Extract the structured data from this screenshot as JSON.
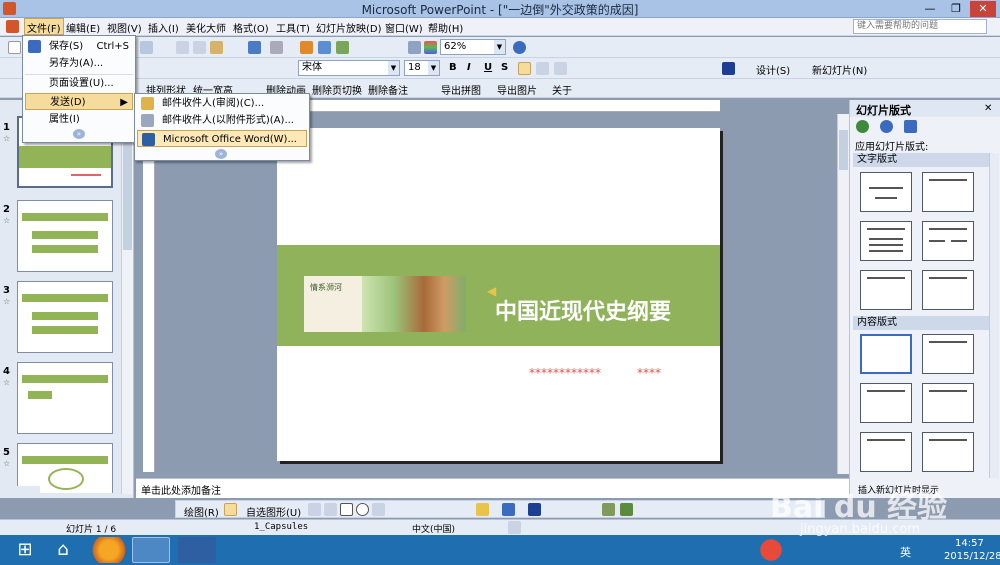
{
  "window": {
    "title": "Microsoft PowerPoint - [\"一边倒\"外交政策的成因]",
    "help_placeholder": "键入需要帮助的问题"
  },
  "menu": [
    "文件(F)",
    "编辑(E)",
    "视图(V)",
    "插入(I)",
    "美化大师",
    "格式(O)",
    "工具(T)",
    "幻灯片放映(D)",
    "窗口(W)",
    "帮助(H)"
  ],
  "toolbar": {
    "zoom": "62%",
    "font": "宋体",
    "size": "18",
    "bold": "B",
    "italic": "I",
    "underline": "U",
    "shadow": "S",
    "design": "设计(S)",
    "new_slide": "新幻灯片(N)"
  },
  "toolbar3": {
    "arrange": "排列形状",
    "uniform": "统一宽高",
    "delete_anim": "删除动画",
    "delete_transition": "删除页切换",
    "delete_notes": "删除备注",
    "export_puzzle": "导出拼图",
    "export_pic": "导出图片",
    "about": "关于"
  },
  "file_menu": {
    "save": "保存(S)",
    "save_shortcut": "Ctrl+S",
    "save_as": "另存为(A)...",
    "page_setup": "页面设置(U)...",
    "send": "发送(D)",
    "properties": "属性(I)"
  },
  "send_menu": {
    "mail_review": "邮件收件人(审阅)(C)...",
    "mail_attach": "邮件收件人(以附件形式)(A)...",
    "word": "Microsoft Office Word(W)..."
  },
  "slides": [
    {
      "num": "1"
    },
    {
      "num": "2"
    },
    {
      "num": "3"
    },
    {
      "num": "4"
    },
    {
      "num": "5"
    }
  ],
  "slide": {
    "title": "中国近现代史纲要",
    "stars_a": "************",
    "stars_b": "****",
    "photo_text": "情系浉河"
  },
  "notes_placeholder": "单击此处添加备注",
  "taskpane": {
    "title": "幻灯片版式",
    "apply": "应用幻灯片版式:",
    "text_layouts": "文字版式",
    "content_layouts": "内容版式",
    "footer_hint": "插入新幻灯片时显示"
  },
  "drawbar": {
    "draw": "绘图(R)",
    "autoshape": "自选图形(U)"
  },
  "status": {
    "slide": "幻灯片 1 / 6",
    "design": "1_Capsules",
    "lang": "中文(中国)"
  },
  "tray": {
    "time": "14:57",
    "date": "2015/12/28",
    "ime": "英"
  },
  "watermark": {
    "brand": "Bai du 经验",
    "url": "jingyan.baidu.com"
  }
}
